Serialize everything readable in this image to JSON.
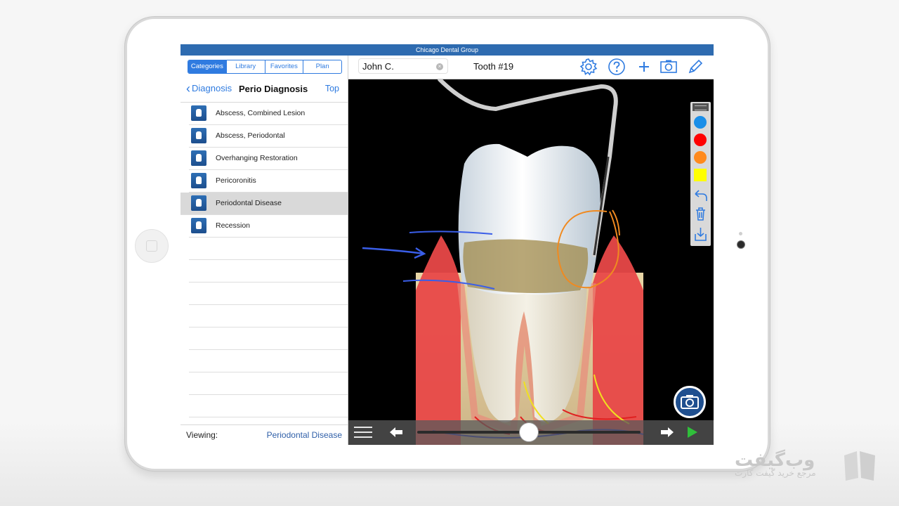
{
  "status_bar": {
    "title": "Chicago Dental Group"
  },
  "sidebar": {
    "tabs": [
      {
        "label": "Categories",
        "selected": true
      },
      {
        "label": "Library",
        "selected": false
      },
      {
        "label": "Favorites",
        "selected": false
      },
      {
        "label": "Plan",
        "selected": false
      }
    ],
    "nav": {
      "back_label": "Diagnosis",
      "title": "Perio Diagnosis",
      "top_label": "Top"
    },
    "items": [
      {
        "label": "Abscess, Combined Lesion",
        "selected": false
      },
      {
        "label": "Abscess, Periodontal",
        "selected": false
      },
      {
        "label": "Overhanging Restoration",
        "selected": false
      },
      {
        "label": "Pericoronitis",
        "selected": false
      },
      {
        "label": "Periodontal Disease",
        "selected": true
      },
      {
        "label": "Recession",
        "selected": false
      }
    ],
    "viewing": {
      "label": "Viewing:",
      "value": "Periodontal Disease"
    }
  },
  "toolbar": {
    "patient_value": "John C.",
    "tooth_label": "Tooth #19",
    "icons": [
      "gear-icon",
      "help-icon",
      "plus-icon",
      "camera-icon",
      "pencil-icon"
    ]
  },
  "palette": {
    "colors": [
      "#1a8ee8",
      "#ff0000",
      "#ff8a1c",
      "#ffff00"
    ],
    "icons": [
      "undo-icon",
      "trash-icon",
      "download-icon"
    ]
  },
  "playback": {
    "progress": 0.5
  },
  "watermark": {
    "brand": "وب‌گیفت",
    "tagline": "مرجع خرید گیفت کارت"
  },
  "colors": {
    "accent": "#2f7be0",
    "status_bar": "#2e6bb0",
    "fab": "#1f4f8f"
  }
}
